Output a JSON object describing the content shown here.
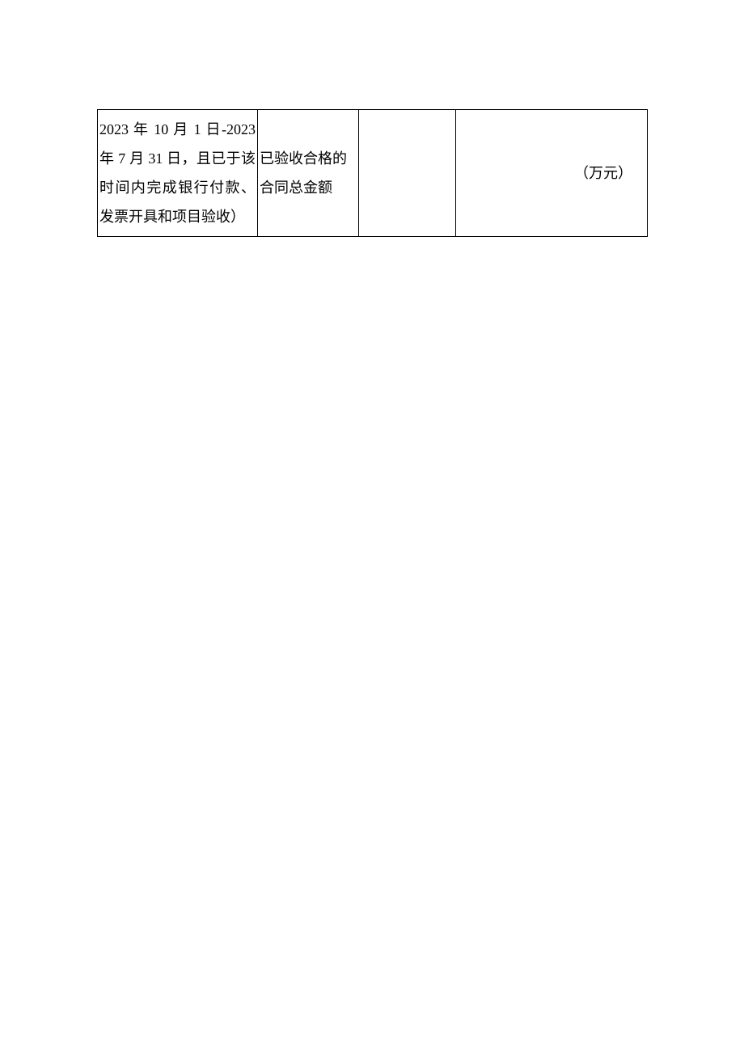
{
  "table": {
    "row": {
      "col1": "2023 年 10 月 1 日-2023 年 7 月 31 日，且已于该时间内完成银行付款、发票开具和项目验收）",
      "col2": "已验收合格的合同总金额",
      "col3": "",
      "col4": "（万元）"
    }
  }
}
